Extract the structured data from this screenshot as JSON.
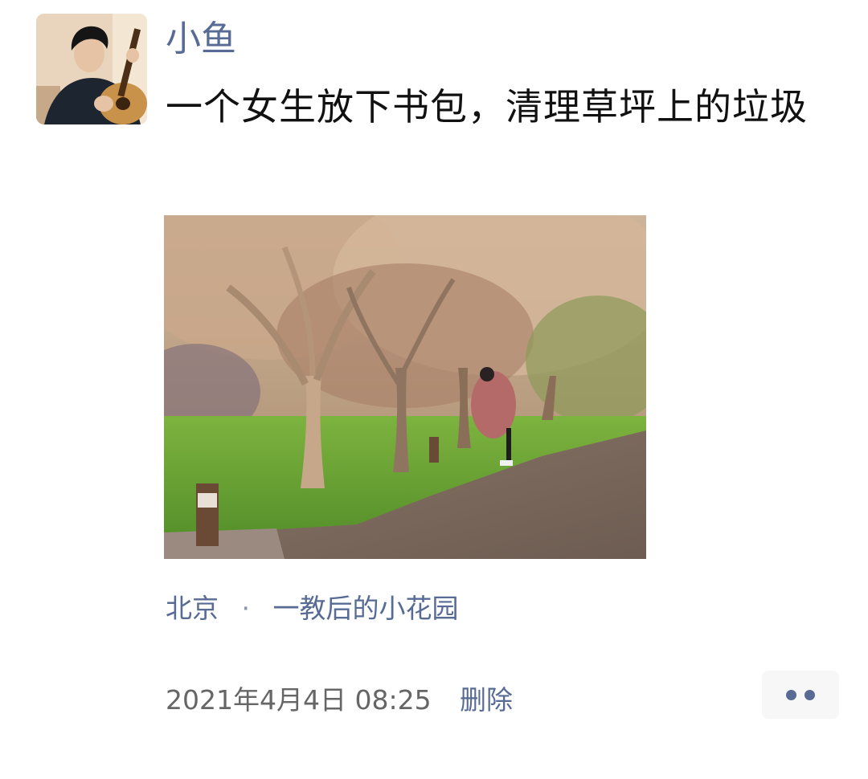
{
  "post": {
    "author": "小鱼",
    "text": "一个女生放下书包，清理草坪上的垃圾",
    "location": {
      "city": "北京",
      "separator": "·",
      "place": "一教后的小花园"
    },
    "timestamp": "2021年4月4日 08:25",
    "delete_label": "删除",
    "more_icon": "more-dots-icon"
  },
  "colors": {
    "link": "#576b95",
    "text": "#111111",
    "meta": "#666666",
    "more_bg": "#f7f7f7"
  }
}
